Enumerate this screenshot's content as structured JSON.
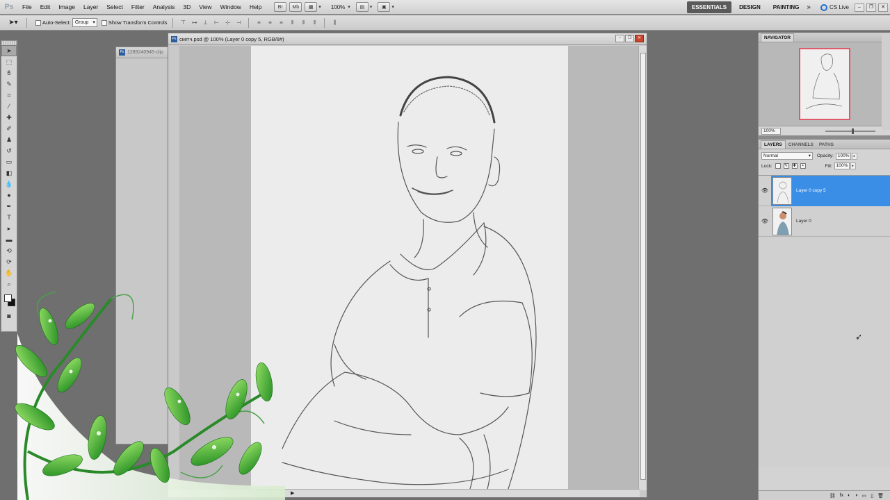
{
  "app": {
    "logo": "Ps"
  },
  "menu": [
    "File",
    "Edit",
    "Image",
    "Layer",
    "Select",
    "Filter",
    "Analysis",
    "3D",
    "View",
    "Window",
    "Help"
  ],
  "menubar_tools": {
    "bridge": "Br",
    "minibridge": "Mb",
    "zoom": "100%"
  },
  "workspaces": {
    "essentials": "ESSENTIALS",
    "design": "DESIGN",
    "painting": "PAINTING",
    "more": "»",
    "cslive": "CS Live"
  },
  "options": {
    "auto_select_label": "Auto-Select:",
    "auto_select_value": "Group",
    "show_transform_label": "Show Transform Controls"
  },
  "documents": {
    "back_title": "1289240945-clip",
    "main_title": "скетч.psd @ 100% (Layer 0 copy 5, RGB/8#)"
  },
  "navigator": {
    "tab": "NAVIGATOR",
    "zoom": "100%"
  },
  "layers_panel": {
    "tabs": [
      "LAYERS",
      "CHANNELS",
      "PATHS"
    ],
    "blend_mode": "Normal",
    "opacity_label": "Opacity:",
    "opacity_value": "100%",
    "lock_label": "Lock:",
    "fill_label": "Fill:",
    "fill_value": "100%",
    "layers": [
      {
        "name": "Layer 0 copy 5",
        "selected": true
      },
      {
        "name": "Layer 0",
        "selected": false
      }
    ]
  },
  "colors": {
    "selection": "#3a8ee6",
    "active_workspace": "#5a5a5a",
    "nav_frame": "#e05a6a"
  }
}
